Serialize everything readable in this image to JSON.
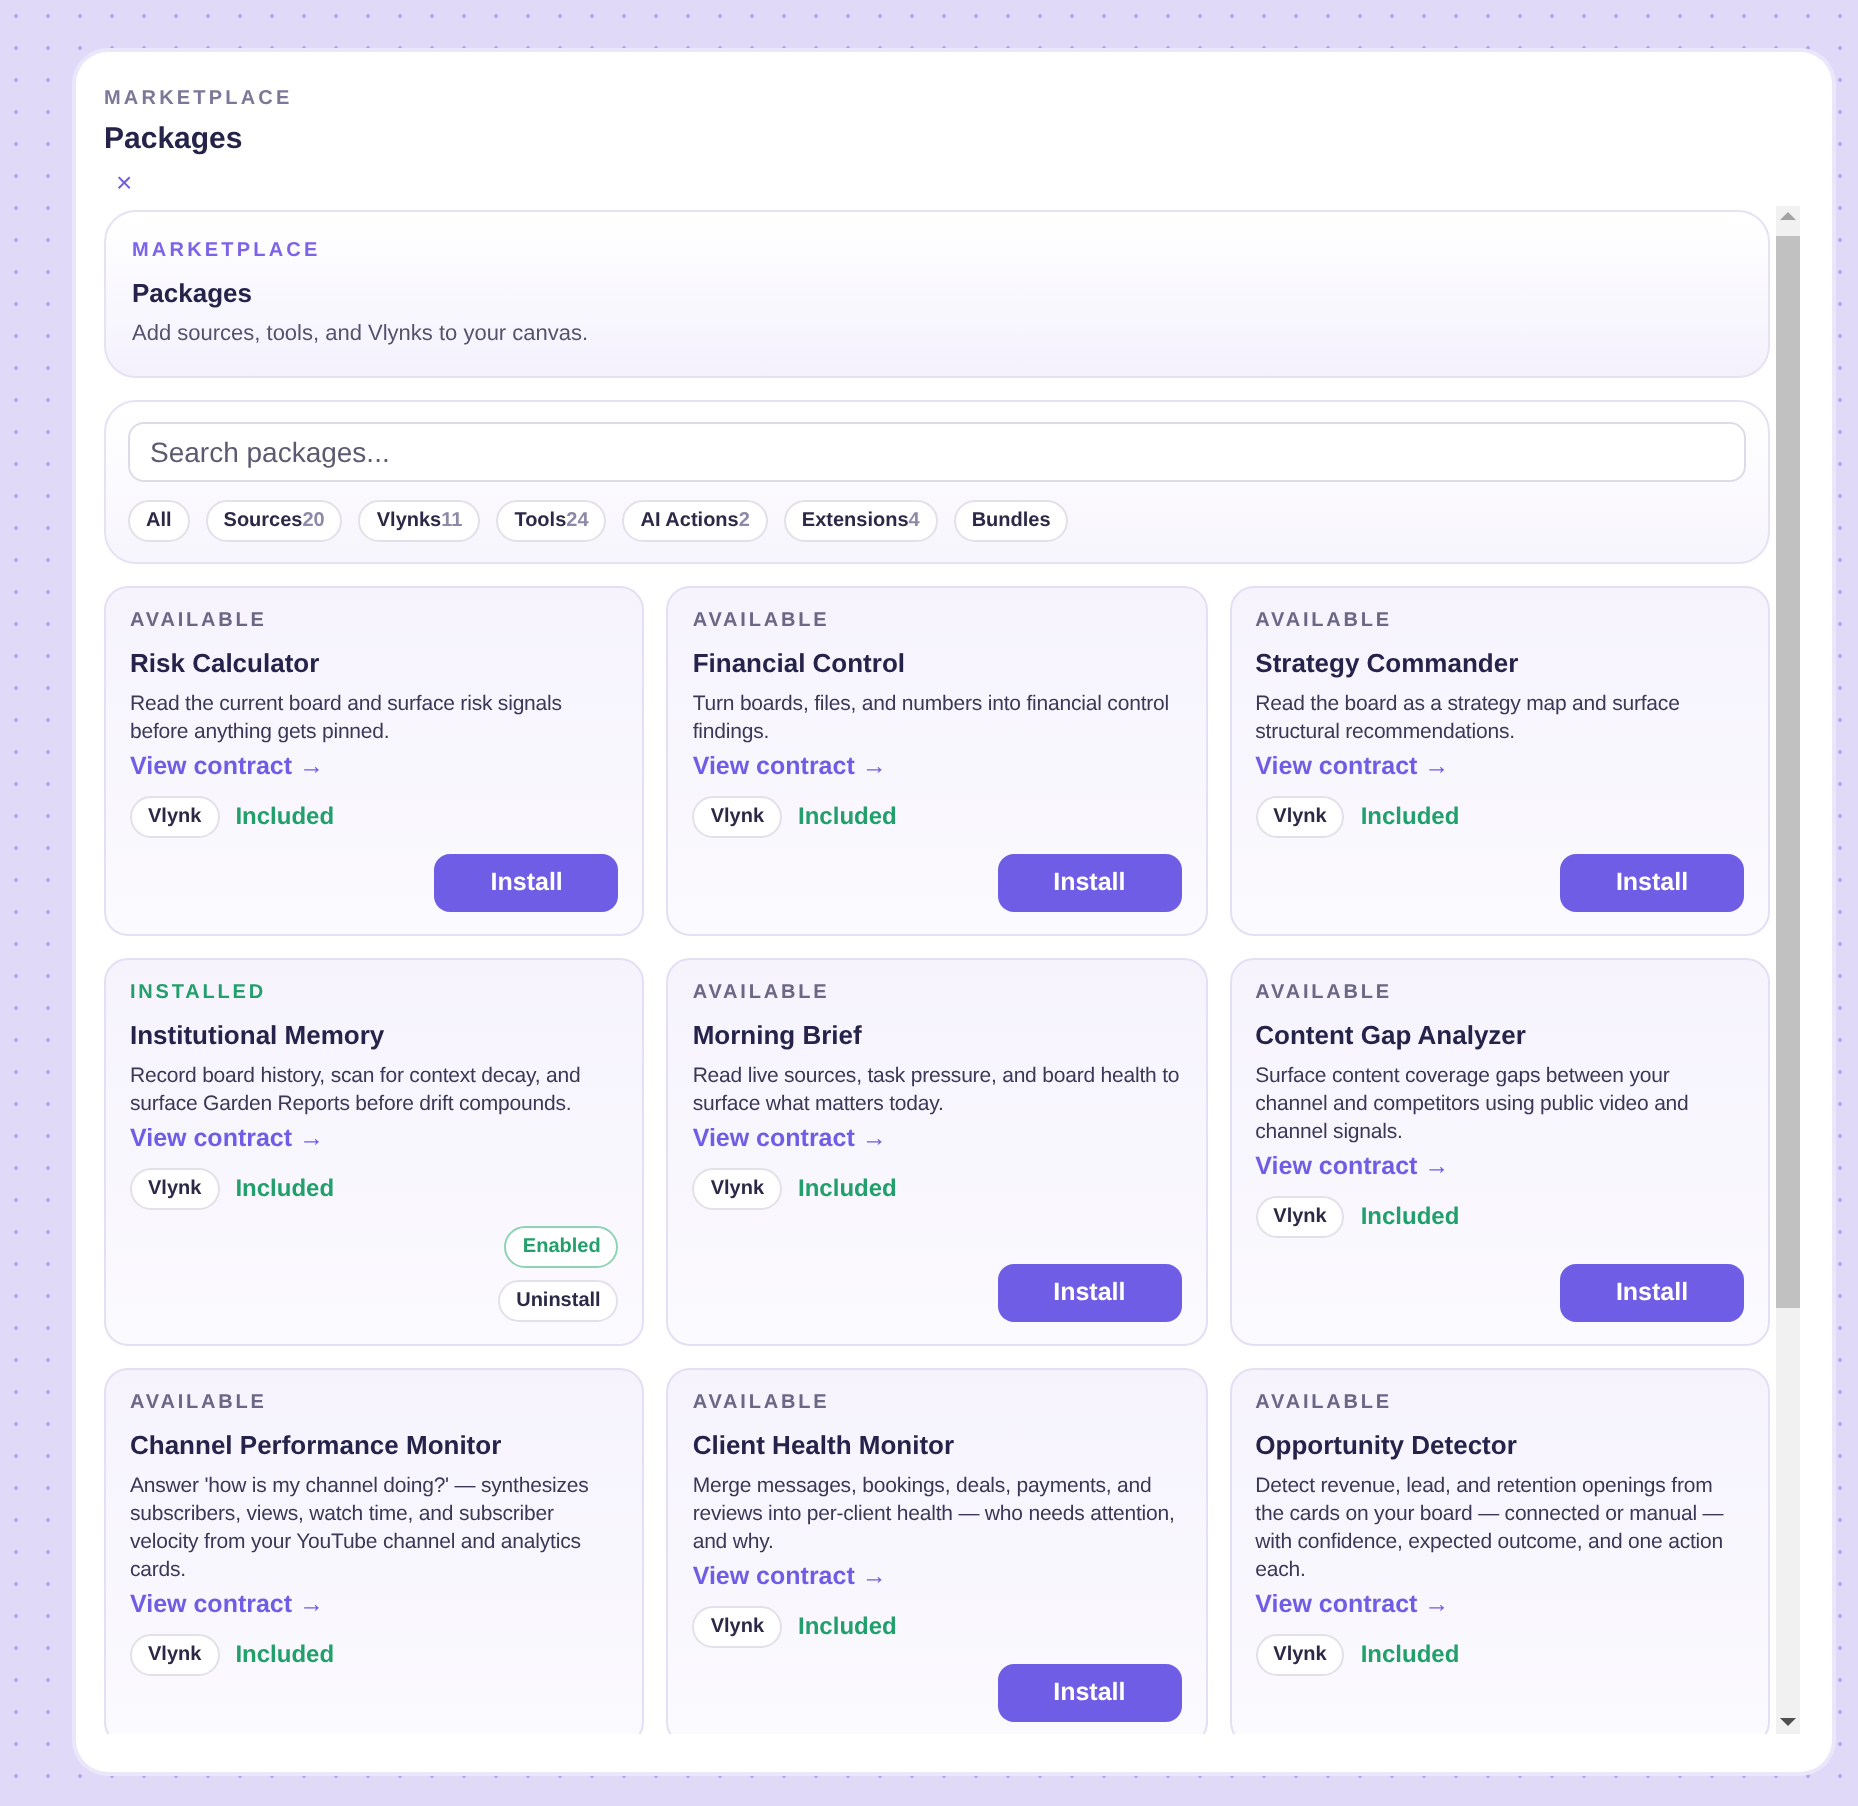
{
  "header": {
    "eyebrow": "MARKETPLACE",
    "title": "Packages",
    "close": "×"
  },
  "hero": {
    "eyebrow": "MARKETPLACE",
    "title": "Packages",
    "subtitle": "Add sources, tools, and Vlynks to your canvas."
  },
  "search": {
    "placeholder": "Search packages..."
  },
  "filters": [
    {
      "label": "All"
    },
    {
      "label": "Sources",
      "count": "20"
    },
    {
      "label": "Vlynks",
      "count": "11"
    },
    {
      "label": "Tools",
      "count": "24"
    },
    {
      "label": "AI Actions",
      "count": "2"
    },
    {
      "label": "Extensions",
      "count": "4"
    },
    {
      "label": "Bundles"
    }
  ],
  "packages": [
    {
      "kind": "available",
      "status": "AVAILABLE",
      "name": "Risk Calculator",
      "description": "Read the current board and surface risk signals before anything gets pinned.",
      "link": "View contract →",
      "tag": "Vlynk",
      "price": "Included",
      "actions": [
        "Install"
      ]
    },
    {
      "kind": "available",
      "status": "AVAILABLE",
      "name": "Financial Control",
      "description": "Turn boards, files, and numbers into financial control findings.",
      "link": "View contract →",
      "tag": "Vlynk",
      "price": "Included",
      "actions": [
        "Install"
      ]
    },
    {
      "kind": "available",
      "status": "AVAILABLE",
      "name": "Strategy Commander",
      "description": "Read the board as a strategy map and surface structural recommendations.",
      "link": "View contract →",
      "tag": "Vlynk",
      "price": "Included",
      "actions": [
        "Install"
      ]
    },
    {
      "kind": "installed",
      "status": "INSTALLED",
      "name": "Institutional Memory",
      "description": "Record board history, scan for context decay, and surface Garden Reports before drift compounds.",
      "link": "View contract →",
      "tag": "Vlynk",
      "price": "Included",
      "actions": [
        "Enabled",
        "Uninstall"
      ]
    },
    {
      "kind": "available",
      "status": "AVAILABLE",
      "name": "Morning Brief",
      "description": "Read live sources, task pressure, and board health to surface what matters today.",
      "link": "View contract →",
      "tag": "Vlynk",
      "price": "Included",
      "actions": [
        "Install"
      ]
    },
    {
      "kind": "available",
      "status": "AVAILABLE",
      "name": "Content Gap Analyzer",
      "description": "Surface content coverage gaps between your channel and competitors using public video and channel signals.",
      "link": "View contract →",
      "tag": "Vlynk",
      "price": "Included",
      "actions": [
        "Install"
      ]
    },
    {
      "kind": "available",
      "status": "AVAILABLE",
      "name": "Channel Performance Monitor",
      "description": "Answer 'how is my channel doing?' — synthesizes subscribers, views, watch time, and subscriber velocity from your YouTube channel and analytics cards.",
      "link": "View contract →",
      "tag": "Vlynk",
      "price": "Included"
    },
    {
      "kind": "available",
      "status": "AVAILABLE",
      "name": "Client Health Monitor",
      "description": "Merge messages, bookings, deals, payments, and reviews into per-client health — who needs attention, and why.",
      "link": "View contract →",
      "tag": "Vlynk",
      "price": "Included",
      "actions": [
        "Install"
      ]
    },
    {
      "kind": "available",
      "status": "AVAILABLE",
      "name": "Opportunity Detector",
      "description": "Detect revenue, lead, and retention openings from the cards on your board — connected or manual — with confidence, expected outcome, and one action each.",
      "link": "View contract →",
      "tag": "Vlynk",
      "price": "Included"
    }
  ]
}
